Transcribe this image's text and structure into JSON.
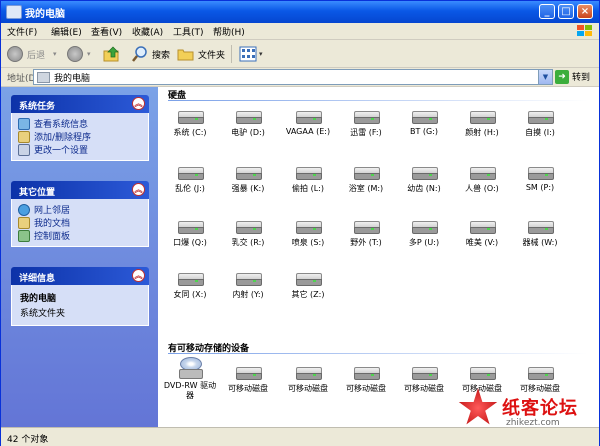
{
  "window": {
    "title": "我的电脑"
  },
  "menu": [
    "文件(F)",
    "编辑(E)",
    "查看(V)",
    "收藏(A)",
    "工具(T)",
    "帮助(H)"
  ],
  "toolbar": {
    "back": "后退",
    "search": "搜索",
    "folders": "文件夹"
  },
  "address": {
    "label": "地址(D)",
    "value": "我的电脑",
    "go": "转到"
  },
  "left_panels": {
    "tasks": {
      "title": "系统任务",
      "items": [
        "查看系统信息",
        "添加/删除程序",
        "更改一个设置"
      ]
    },
    "places": {
      "title": "其它位置",
      "items": [
        "网上邻居",
        "我的文档",
        "控制面板"
      ]
    },
    "details": {
      "title": "详细信息",
      "name": "我的电脑",
      "desc": "系统文件夹"
    }
  },
  "sections": {
    "hdd": "硬盘",
    "removable": "有可移动存储的设备"
  },
  "drives": [
    "系统 (C:)",
    "电驴 (D:)",
    "VAGAA (E:)",
    "迅雷 (F:)",
    "BT (G:)",
    "颜射 (H:)",
    "自摸 (I:)",
    "乱伦 (J:)",
    "强暴 (K:)",
    "偷拍 (L:)",
    "浴室 (M:)",
    "幼齿 (N:)",
    "人兽 (O:)",
    "SM (P:)",
    "口爆 (Q:)",
    "乳交 (R:)",
    "喷泉 (S:)",
    "野外 (T:)",
    "多P (U:)",
    "唯美 (V:)",
    "器械 (W:)",
    "女同 (X:)",
    "内射 (Y:)",
    "其它 (Z:)"
  ],
  "removable": [
    "DVD-RW 驱动器",
    "可移动磁盘",
    "可移动磁盘",
    "可移动磁盘",
    "可移动磁盘",
    "可移动磁盘",
    "可移动磁盘"
  ],
  "status": {
    "text": "42 个对象"
  },
  "watermark": {
    "text": "纸客论坛",
    "sub": "zhikezt.com"
  }
}
